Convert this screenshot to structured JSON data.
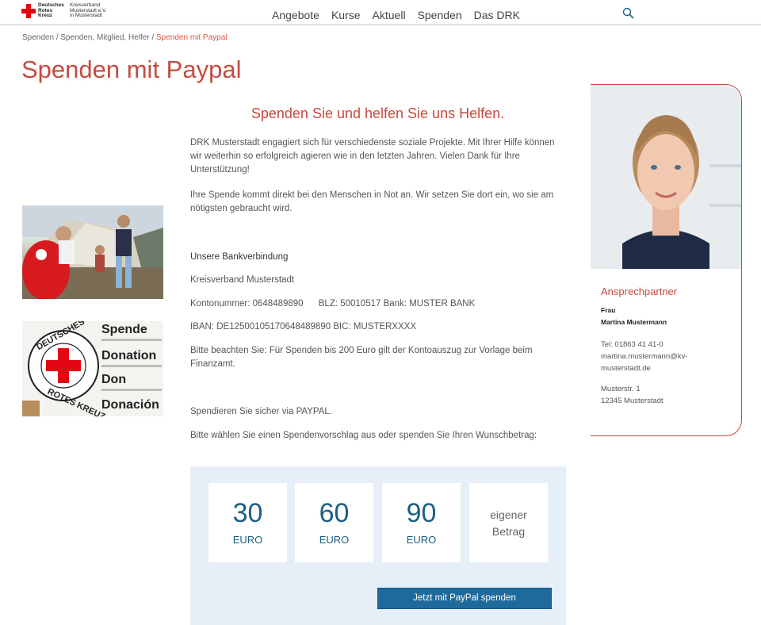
{
  "header": {
    "logo_org": "Deutsches Rotes Kreuz",
    "logo_kv": "Kreisverband Musterstadt e.V. in Musterstadt",
    "nav": [
      "Angebote",
      "Kurse",
      "Aktuell",
      "Spenden",
      "Das DRK"
    ]
  },
  "breadcrumb": {
    "trail": "Spenden / Spenden, Mitglied, Helfer / ",
    "current": "Spenden mit Paypal"
  },
  "page_title": "Spenden mit Paypal",
  "main": {
    "subheading": "Spenden Sie und helfen Sie uns Helfen.",
    "intro": "DRK Musterstadt engagiert sich für verschiedenste soziale Projekte. Mit Ihrer Hilfe können wir weiterhin so erfolgreich agieren wie in den letzten Jahren. Vielen Dank für Ihre Unterstützung!",
    "intro2": "Ihre Spende kommt direkt bei den Menschen in Not an. Wir setzen Sie dort ein, wo sie am nötigsten gebraucht wird.",
    "bank_title": "Unsere Bankverbindung",
    "bank_name": "Kreisverband Musterstadt",
    "bank_account": "Kontonummer: 0648489890      BLZ: 50010517 Bank: MUSTER BANK",
    "iban": "IBAN: DE12500105170648489890 BIC: MUSTERXXXX",
    "note": "Bitte beachten Sie: Für Spenden bis 200 Euro gilt der Kontoauszug zur Vorlage beim Finanzamt.",
    "paypal_info": "Spendieren Sie sicher via PAYPAL.",
    "choose": "Bitte wählen Sie einen Spendenvorschlag aus oder spenden Sie Ihren Wunschbetrag:"
  },
  "photo2_text": {
    "words": [
      "Spende",
      "Donation",
      "Don",
      "Donación"
    ],
    "seal_top": "DEUTSCHES",
    "seal_bottom": "ROTES KREUZ"
  },
  "contact": {
    "heading": "Ansprechpartner",
    "salutation": "Frau",
    "name": "Martina Mustermann",
    "phone": "Tel: 01863 41 41-0",
    "email1": "martina.mustermann@kv-",
    "email2": "musterstadt.de",
    "street": "Musterstr. 1",
    "city": "12345 Musterstadt"
  },
  "donation": {
    "options": [
      {
        "amount": "30",
        "currency": "EURO"
      },
      {
        "amount": "60",
        "currency": "EURO"
      },
      {
        "amount": "90",
        "currency": "EURO"
      }
    ],
    "custom_line1": "eigener",
    "custom_line2": "Betrag",
    "button_label": "Jetzt mit PayPal spenden"
  },
  "colors": {
    "accent_red": "#c54a3f",
    "drk_red": "#e30613",
    "button_blue": "#1e6a9b",
    "box_bg": "#e6eff8"
  }
}
